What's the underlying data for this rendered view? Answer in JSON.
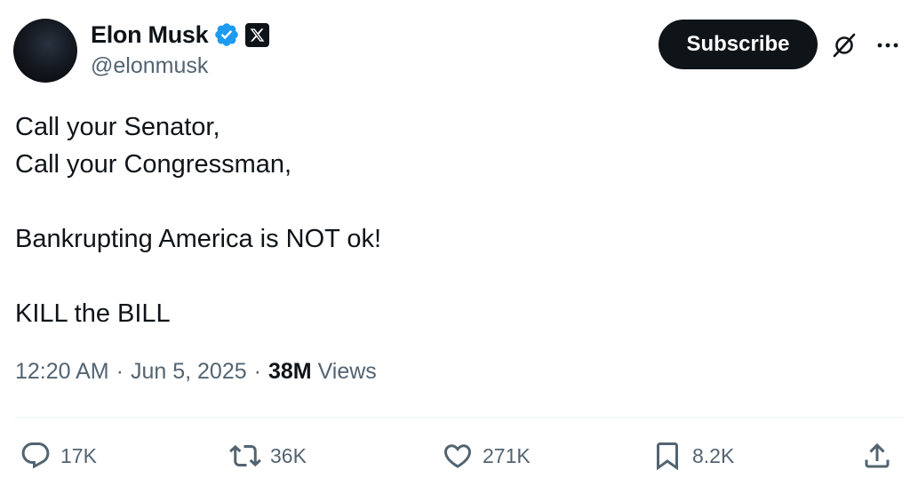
{
  "author": {
    "name": "Elon Musk",
    "handle": "@elonmusk",
    "verified_color": "#1d9bf0"
  },
  "header": {
    "subscribe_label": "Subscribe",
    "icons": [
      "grok-icon",
      "more-icon"
    ]
  },
  "post": {
    "lines": [
      "Call your Senator,",
      "Call your Congressman,",
      "",
      "Bankrupting America is NOT ok!",
      "",
      "KILL the BILL"
    ]
  },
  "meta": {
    "time": "12:20 AM",
    "separator": "·",
    "date": "Jun 5, 2025",
    "views_count": "38M",
    "views_label": "Views"
  },
  "actions": {
    "replies": "17K",
    "reposts": "36K",
    "likes": "271K",
    "bookmarks": "8.2K"
  }
}
